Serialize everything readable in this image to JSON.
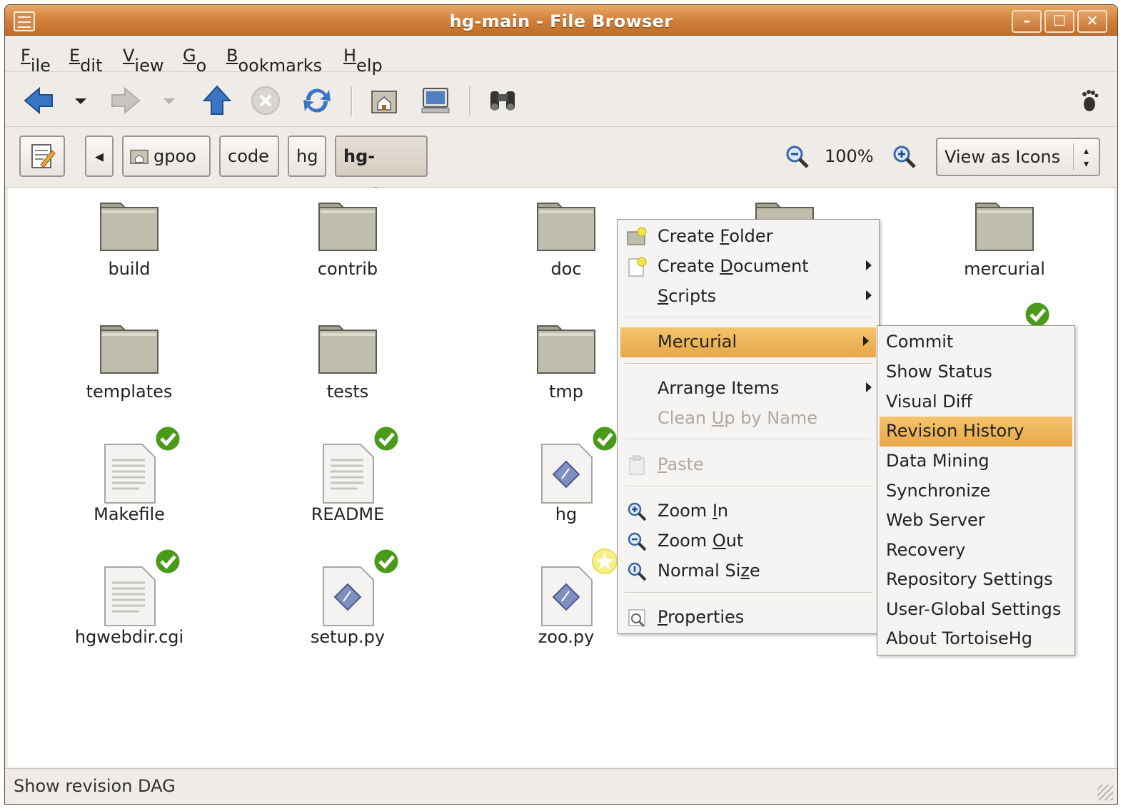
{
  "window": {
    "title": "hg-main - File Browser"
  },
  "menubar": {
    "file": {
      "pre": "",
      "u": "F",
      "post": "ile"
    },
    "edit": {
      "pre": "",
      "u": "E",
      "post": "dit"
    },
    "view": {
      "pre": "",
      "u": "V",
      "post": "iew"
    },
    "go": {
      "pre": "",
      "u": "G",
      "post": "o"
    },
    "bookmarks": {
      "pre": "",
      "u": "B",
      "post": "ookmarks"
    },
    "help": {
      "pre": "",
      "u": "H",
      "post": "elp"
    }
  },
  "toolbar": {
    "icons": [
      "back-icon",
      "back-history-dropdown",
      "forward-icon",
      "forward-history-dropdown",
      "up-icon",
      "stop-icon",
      "reload-icon",
      "home-icon",
      "computer-icon",
      "search-icon",
      "throbber-foot-icon"
    ]
  },
  "location": {
    "path": [
      "gpoo",
      "code",
      "hg",
      "hg-main"
    ],
    "zoom": "100%",
    "view_mode": "View as Icons"
  },
  "files": [
    {
      "name": "build",
      "type": "folder"
    },
    {
      "name": "contrib",
      "type": "folder"
    },
    {
      "name": "doc",
      "type": "folder"
    },
    {
      "name": "mercurial",
      "type": "folder"
    },
    {
      "name": "templates",
      "type": "folder"
    },
    {
      "name": "tests",
      "type": "folder"
    },
    {
      "name": "tmp",
      "type": "folder"
    },
    {
      "name": "Makefile",
      "type": "text",
      "emblem": "ok"
    },
    {
      "name": "README",
      "type": "text",
      "emblem": "ok"
    },
    {
      "name": "hg",
      "type": "script",
      "emblem": "ok"
    },
    {
      "name": "hgwebdir.cgi",
      "type": "text",
      "emblem": "ok"
    },
    {
      "name": "setup.py",
      "type": "script",
      "emblem": "ok"
    },
    {
      "name": "zoo.py",
      "type": "script",
      "emblem": "added"
    }
  ],
  "context_menu": {
    "create_folder": {
      "pre": "Create ",
      "u": "F",
      "post": "older"
    },
    "create_document": {
      "pre": "Create ",
      "u": "D",
      "post": "ocument"
    },
    "scripts": {
      "pre": "",
      "u": "S",
      "post": "cripts"
    },
    "mercurial": {
      "pre": "",
      "u": "",
      "post": "Mercurial"
    },
    "arrange_items": {
      "pre": "Arrange Items",
      "u": "",
      "post": ""
    },
    "clean_up": {
      "pre": "Clean ",
      "u": "U",
      "post": "p by Name"
    },
    "paste": {
      "pre": "",
      "u": "P",
      "post": "aste"
    },
    "zoom_in": {
      "pre": "Zoom ",
      "u": "I",
      "post": "n"
    },
    "zoom_out": {
      "pre": "Zoom ",
      "u": "O",
      "post": "ut"
    },
    "normal_size": {
      "pre": "Normal Si",
      "u": "z",
      "post": "e"
    },
    "properties": {
      "pre": "",
      "u": "P",
      "post": "roperties"
    }
  },
  "mercurial_submenu": {
    "items": [
      "Commit",
      "Show Status",
      "Visual Diff",
      "Revision History",
      "Data Mining",
      "Synchronize",
      "Web Server",
      "Recovery",
      "Repository Settings",
      "User-Global Settings",
      "About TortoiseHg"
    ],
    "highlighted": "Revision History"
  },
  "status": {
    "text": "Show revision DAG"
  },
  "colors": {
    "titlebar": "#cf7d38",
    "highlight": "#eeb35a",
    "emblem_ok": "#4a9a1a"
  }
}
